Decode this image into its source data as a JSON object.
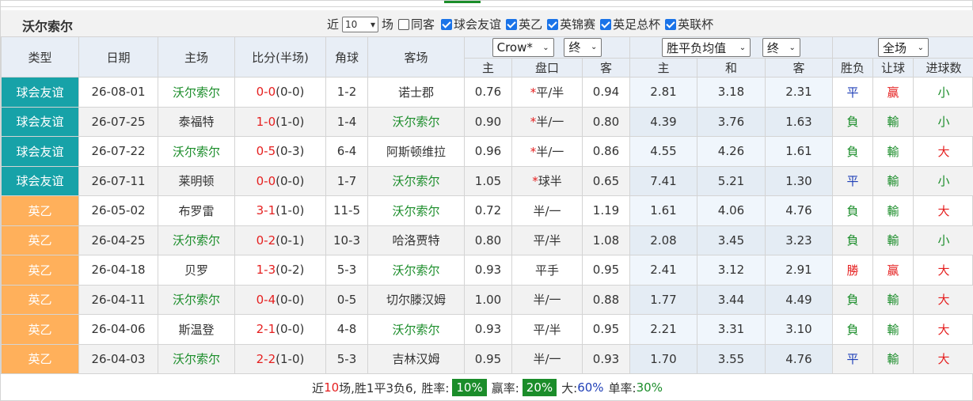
{
  "team_name": "沃尔索尔",
  "filters": {
    "recent_label": "近",
    "recent_count": "10",
    "games_label": "场",
    "same_home_label": "同客",
    "competitions": [
      "球会友谊",
      "英乙",
      "英锦赛",
      "英足总杯",
      "英联杯"
    ]
  },
  "columns": {
    "type": "类型",
    "date": "日期",
    "home": "主场",
    "score": "比分(半场)",
    "corners": "角球",
    "away": "客场",
    "company": "Crow*",
    "odds_state1": "终",
    "avg_select": "胜平负均值",
    "odds_state2": "终",
    "all_select": "全场",
    "sub_home": "主",
    "sub_line": "盘口",
    "sub_away": "客",
    "sub_win": "主",
    "sub_draw": "和",
    "sub_lose": "客",
    "sub_result": "胜负",
    "sub_handicap": "让球",
    "sub_goals": "进球数"
  },
  "colors": {
    "friendly": "#17a2a8",
    "league": "#ffb05b",
    "team_highlight": "#1b8d2a",
    "score_red": "#e51f1f",
    "draw_blue": "#1f3fb7"
  },
  "matches": [
    {
      "type": "球会友谊",
      "kind": "friendly",
      "date": "26-08-01",
      "home": "沃尔索尔",
      "home_hl": true,
      "score": "0-0",
      "half": "(0-0)",
      "corners": "1-2",
      "away": "诺士郡",
      "away_hl": false,
      "h_odds": "0.76",
      "line": "*平/半",
      "line_star": true,
      "a_odds": "0.94",
      "w": "2.81",
      "d": "3.18",
      "l": "2.31",
      "result": "平",
      "handicap": "赢",
      "goals": "小"
    },
    {
      "type": "球会友谊",
      "kind": "friendly",
      "date": "26-07-25",
      "home": "泰福特",
      "home_hl": false,
      "score": "1-0",
      "half": "(1-0)",
      "corners": "1-4",
      "away": "沃尔索尔",
      "away_hl": true,
      "h_odds": "0.90",
      "line": "*半/一",
      "line_star": true,
      "a_odds": "0.80",
      "w": "4.39",
      "d": "3.76",
      "l": "1.63",
      "result": "負",
      "handicap": "輸",
      "goals": "小"
    },
    {
      "type": "球会友谊",
      "kind": "friendly",
      "date": "26-07-22",
      "home": "沃尔索尔",
      "home_hl": true,
      "score": "0-5",
      "half": "(0-3)",
      "corners": "6-4",
      "away": "阿斯顿维拉",
      "away_hl": false,
      "h_odds": "0.96",
      "line": "*半/一",
      "line_star": true,
      "a_odds": "0.86",
      "w": "4.55",
      "d": "4.26",
      "l": "1.61",
      "result": "負",
      "handicap": "輸",
      "goals": "大"
    },
    {
      "type": "球会友谊",
      "kind": "friendly",
      "date": "26-07-11",
      "home": "莱明顿",
      "home_hl": false,
      "score": "0-0",
      "half": "(0-0)",
      "corners": "1-7",
      "away": "沃尔索尔",
      "away_hl": true,
      "h_odds": "1.05",
      "line": "*球半",
      "line_star": true,
      "a_odds": "0.65",
      "w": "7.41",
      "d": "5.21",
      "l": "1.30",
      "result": "平",
      "handicap": "輸",
      "goals": "小"
    },
    {
      "type": "英乙",
      "kind": "league",
      "date": "26-05-02",
      "home": "布罗雷",
      "home_hl": false,
      "score": "3-1",
      "half": "(1-0)",
      "corners": "11-5",
      "away": "沃尔索尔",
      "away_hl": true,
      "h_odds": "0.72",
      "line": "半/一",
      "line_star": false,
      "a_odds": "1.19",
      "w": "1.61",
      "d": "4.06",
      "l": "4.76",
      "result": "負",
      "handicap": "輸",
      "goals": "大"
    },
    {
      "type": "英乙",
      "kind": "league",
      "date": "26-04-25",
      "home": "沃尔索尔",
      "home_hl": true,
      "score": "0-2",
      "half": "(0-1)",
      "corners": "10-3",
      "away": "哈洛贾特",
      "away_hl": false,
      "h_odds": "0.80",
      "line": "平/半",
      "line_star": false,
      "a_odds": "1.08",
      "w": "2.08",
      "d": "3.45",
      "l": "3.23",
      "result": "負",
      "handicap": "輸",
      "goals": "小"
    },
    {
      "type": "英乙",
      "kind": "league",
      "date": "26-04-18",
      "home": "贝罗",
      "home_hl": false,
      "score": "1-3",
      "half": "(0-2)",
      "corners": "5-3",
      "away": "沃尔索尔",
      "away_hl": true,
      "h_odds": "0.93",
      "line": "平手",
      "line_star": false,
      "a_odds": "0.95",
      "w": "2.41",
      "d": "3.12",
      "l": "2.91",
      "result": "勝",
      "handicap": "赢",
      "goals": "大"
    },
    {
      "type": "英乙",
      "kind": "league",
      "date": "26-04-11",
      "home": "沃尔索尔",
      "home_hl": true,
      "score": "0-4",
      "half": "(0-0)",
      "corners": "0-5",
      "away": "切尔滕汉姆",
      "away_hl": false,
      "h_odds": "1.00",
      "line": "半/一",
      "line_star": false,
      "a_odds": "0.88",
      "w": "1.77",
      "d": "3.44",
      "l": "4.49",
      "result": "負",
      "handicap": "輸",
      "goals": "大"
    },
    {
      "type": "英乙",
      "kind": "league",
      "date": "26-04-06",
      "home": "斯温登",
      "home_hl": false,
      "score": "2-1",
      "half": "(0-0)",
      "corners": "4-8",
      "away": "沃尔索尔",
      "away_hl": true,
      "h_odds": "0.93",
      "line": "平/半",
      "line_star": false,
      "a_odds": "0.95",
      "w": "2.21",
      "d": "3.31",
      "l": "3.10",
      "result": "負",
      "handicap": "輸",
      "goals": "大"
    },
    {
      "type": "英乙",
      "kind": "league",
      "date": "26-04-03",
      "home": "沃尔索尔",
      "home_hl": true,
      "score": "2-2",
      "half": "(1-0)",
      "corners": "5-3",
      "away": "吉林汉姆",
      "away_hl": false,
      "h_odds": "0.95",
      "line": "半/一",
      "line_star": false,
      "a_odds": "0.93",
      "w": "1.70",
      "d": "3.55",
      "l": "4.76",
      "result": "平",
      "handicap": "輸",
      "goals": "大"
    }
  ],
  "summary": {
    "prefix": "近",
    "count": "10",
    "record": "场,胜1平3负6,",
    "win_rate_label": "胜率:",
    "win_rate": "10%",
    "cover_rate_label": "赢率:",
    "cover_rate": "20%",
    "big_label": "大:",
    "big_rate": "60%",
    "odd_label": "单率:",
    "odd_rate": "30%"
  }
}
